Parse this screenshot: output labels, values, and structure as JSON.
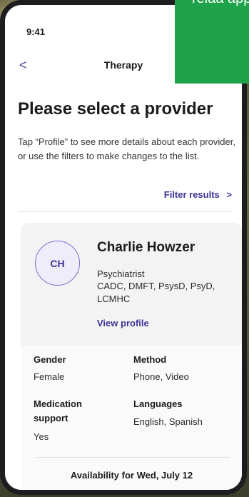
{
  "status_bar": {
    "time": "9:41"
  },
  "nav": {
    "back_icon": "chevron-left-icon",
    "back_glyph": "<",
    "title": "Therapy"
  },
  "page": {
    "title": "Please select a provider",
    "intro": "Tap “Profile” to see more details about each provider, or use the filters to make changes to the list.",
    "filter_label": "Filter results",
    "filter_glyph": ">"
  },
  "provider": {
    "initials": "CH",
    "name": "Charlie Howzer",
    "specialty": "Psychiatrist",
    "credentials": "CADC, DMFT, PsysD, PsyD, LCMHC",
    "view_profile": "View profile",
    "gender_label": "Gender",
    "gender_value": "Female",
    "method_label": "Method",
    "method_value": "Phone, Video",
    "medication_label": "Medication support",
    "medication_value": "Yes",
    "languages_label": "Languages",
    "languages_value": "English, Spanish",
    "availability": "Availability for Wed, July 12"
  },
  "promo": {
    "text": "relaa app"
  },
  "colors": {
    "accent": "#3b3396",
    "promo": "#1fa34a"
  }
}
